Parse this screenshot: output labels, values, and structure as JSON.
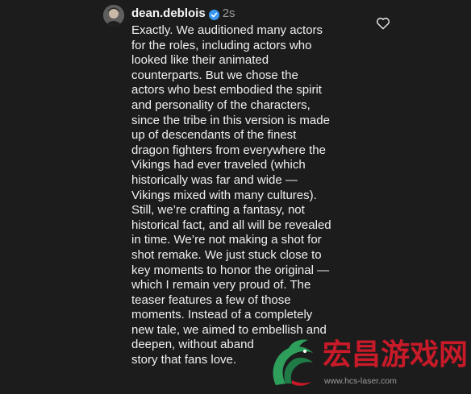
{
  "comment": {
    "username": "dean.deblois",
    "timestamp": "2s",
    "body_lines": [
      "Exactly. We auditioned many actors",
      "for the roles, including actors who",
      "looked like their animated",
      "counterparts. But we chose the",
      "actors who best embodied the spirit",
      "and personality of the characters,",
      "since the tribe in this version is made",
      "up of descendants of the finest",
      "dragon fighters from everywhere the",
      "Vikings had ever traveled (which",
      "historically was far and wide —",
      "Vikings mixed with many cultures).",
      "Still, we’re crafting a fantasy, not",
      "historical fact, and all will be revealed",
      "in time. We’re not making a shot for",
      "shot remake. We just stuck close to",
      "key moments to honor the original —",
      "which I remain very proud of. The",
      "teaser features a few of those",
      "moments. Instead of a completely",
      "new tale, we aimed to embellish and",
      "deepen, without aband",
      "story that fans love."
    ],
    "icons": {
      "avatar": "avatar",
      "verified": "verified-badge-icon",
      "like": "heart-icon"
    },
    "colors": {
      "background": "#1c1c1c",
      "text": "#f0f0f0",
      "verified": "#3897f0",
      "timestamp": "#9a9a9a"
    }
  },
  "watermark": {
    "title": "宏昌游戏网",
    "url": "www.hcs-laser.com",
    "colors": {
      "title": "#c81a28",
      "logo_green": "#2e9e5b"
    }
  }
}
